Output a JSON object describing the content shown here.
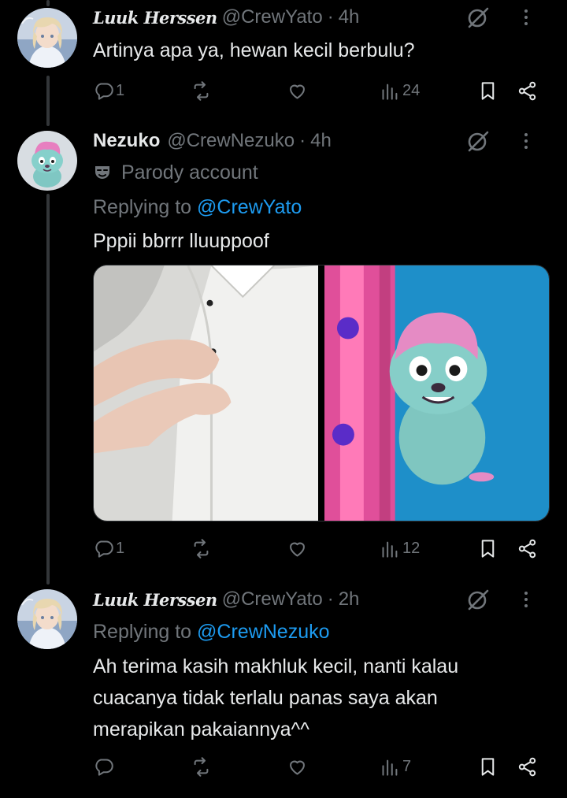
{
  "tweets": [
    {
      "display_name": "Luuk Herssen",
      "handle": "@CrewYato",
      "separator": "·",
      "time": "4h",
      "text_lines": [
        "Artinya apa ya, hewan kecil berbulu?"
      ],
      "replies": "1",
      "views": "24"
    },
    {
      "display_name": "Nezuko",
      "handle": "@CrewNezuko",
      "separator": "·",
      "time": "4h",
      "parody_label": "Parody account",
      "replying_prefix": "Replying to",
      "replying_to": "@CrewYato",
      "text_lines": [
        "Pppii bbrrr lluuppoof"
      ],
      "replies": "1",
      "views": "12"
    },
    {
      "display_name": "Luuk Herssen",
      "handle": "@CrewYato",
      "separator": "·",
      "time": "2h",
      "replying_prefix": "Replying to",
      "replying_to": "@CrewNezuko",
      "text_lines": [
        "Ah terima kasih makhluk kecil, nanti kalau",
        "cuacanya tidak terlalu panas saya akan",
        "merapikan pakaiannya^^"
      ],
      "replies": "",
      "views": "7"
    }
  ],
  "icons": {
    "reply": "reply-icon",
    "retweet": "retweet-icon",
    "like": "heart-icon",
    "views": "views-icon",
    "bookmark": "bookmark-icon",
    "share": "share-icon",
    "grok": "grok-icon",
    "more": "more-icon",
    "parody": "parody-mask-icon"
  },
  "colors": {
    "background": "#000000",
    "text_primary": "#e7e9ea",
    "text_secondary": "#71767b",
    "link": "#1d9bf0",
    "thread_line": "#333639"
  }
}
